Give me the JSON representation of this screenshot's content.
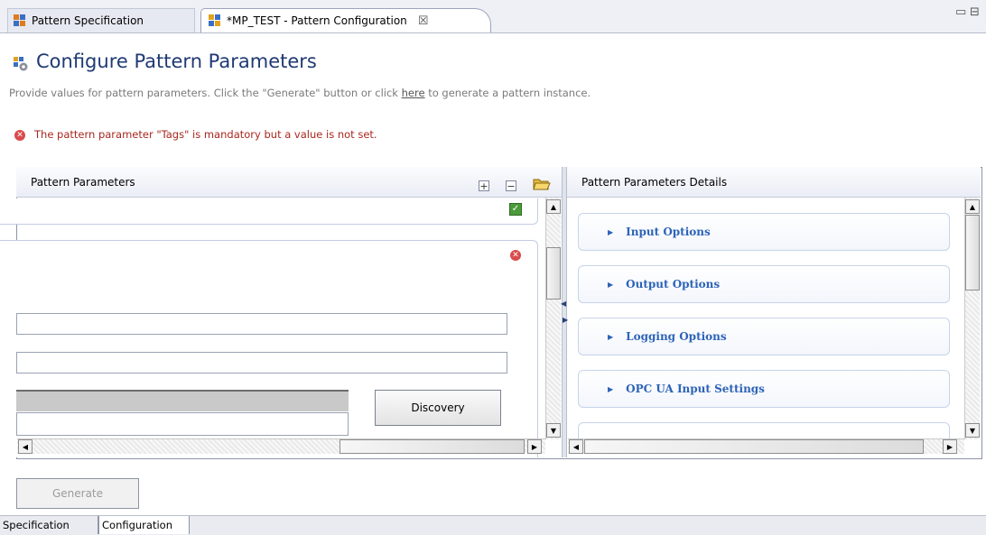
{
  "tabs": {
    "inactive_label": "Pattern Specification",
    "active_label": "*MP_TEST - Pattern Configuration",
    "close_glyph": "☒"
  },
  "window_controls": {
    "minimize": "▭",
    "maximize": "⊟"
  },
  "header": {
    "title": "Configure Pattern Parameters",
    "description_before": "Provide values for pattern parameters. Click the \"Generate\" button or click ",
    "description_link": "here",
    "description_after": " to generate a pattern instance.",
    "error_message": "The pattern parameter \"Tags\" is mandatory but a value is not set."
  },
  "left_panel": {
    "title": "Pattern Parameters",
    "expand_glyph": "+",
    "collapse_glyph": "−",
    "discovery_label": "Discovery"
  },
  "right_panel": {
    "title": "Pattern Parameters Details",
    "sections": [
      {
        "label": "Input Options"
      },
      {
        "label": "Output Options"
      },
      {
        "label": "Logging Options"
      },
      {
        "label": "OPC UA Input Settings"
      }
    ]
  },
  "footer": {
    "generate_label": "Generate",
    "tabs": [
      "Specification",
      "Configuration"
    ]
  },
  "colors": {
    "title": "#1f3a73",
    "error": "#a8281f",
    "section_label": "#2c63b8"
  },
  "icons": {
    "tab_pattern_icon": "pattern-spec-icon",
    "config_icon": "pattern-config-icon",
    "error_icon": "error-icon",
    "valid_icon": "checkmark-icon",
    "open_folder_icon": "open-folder-icon"
  }
}
